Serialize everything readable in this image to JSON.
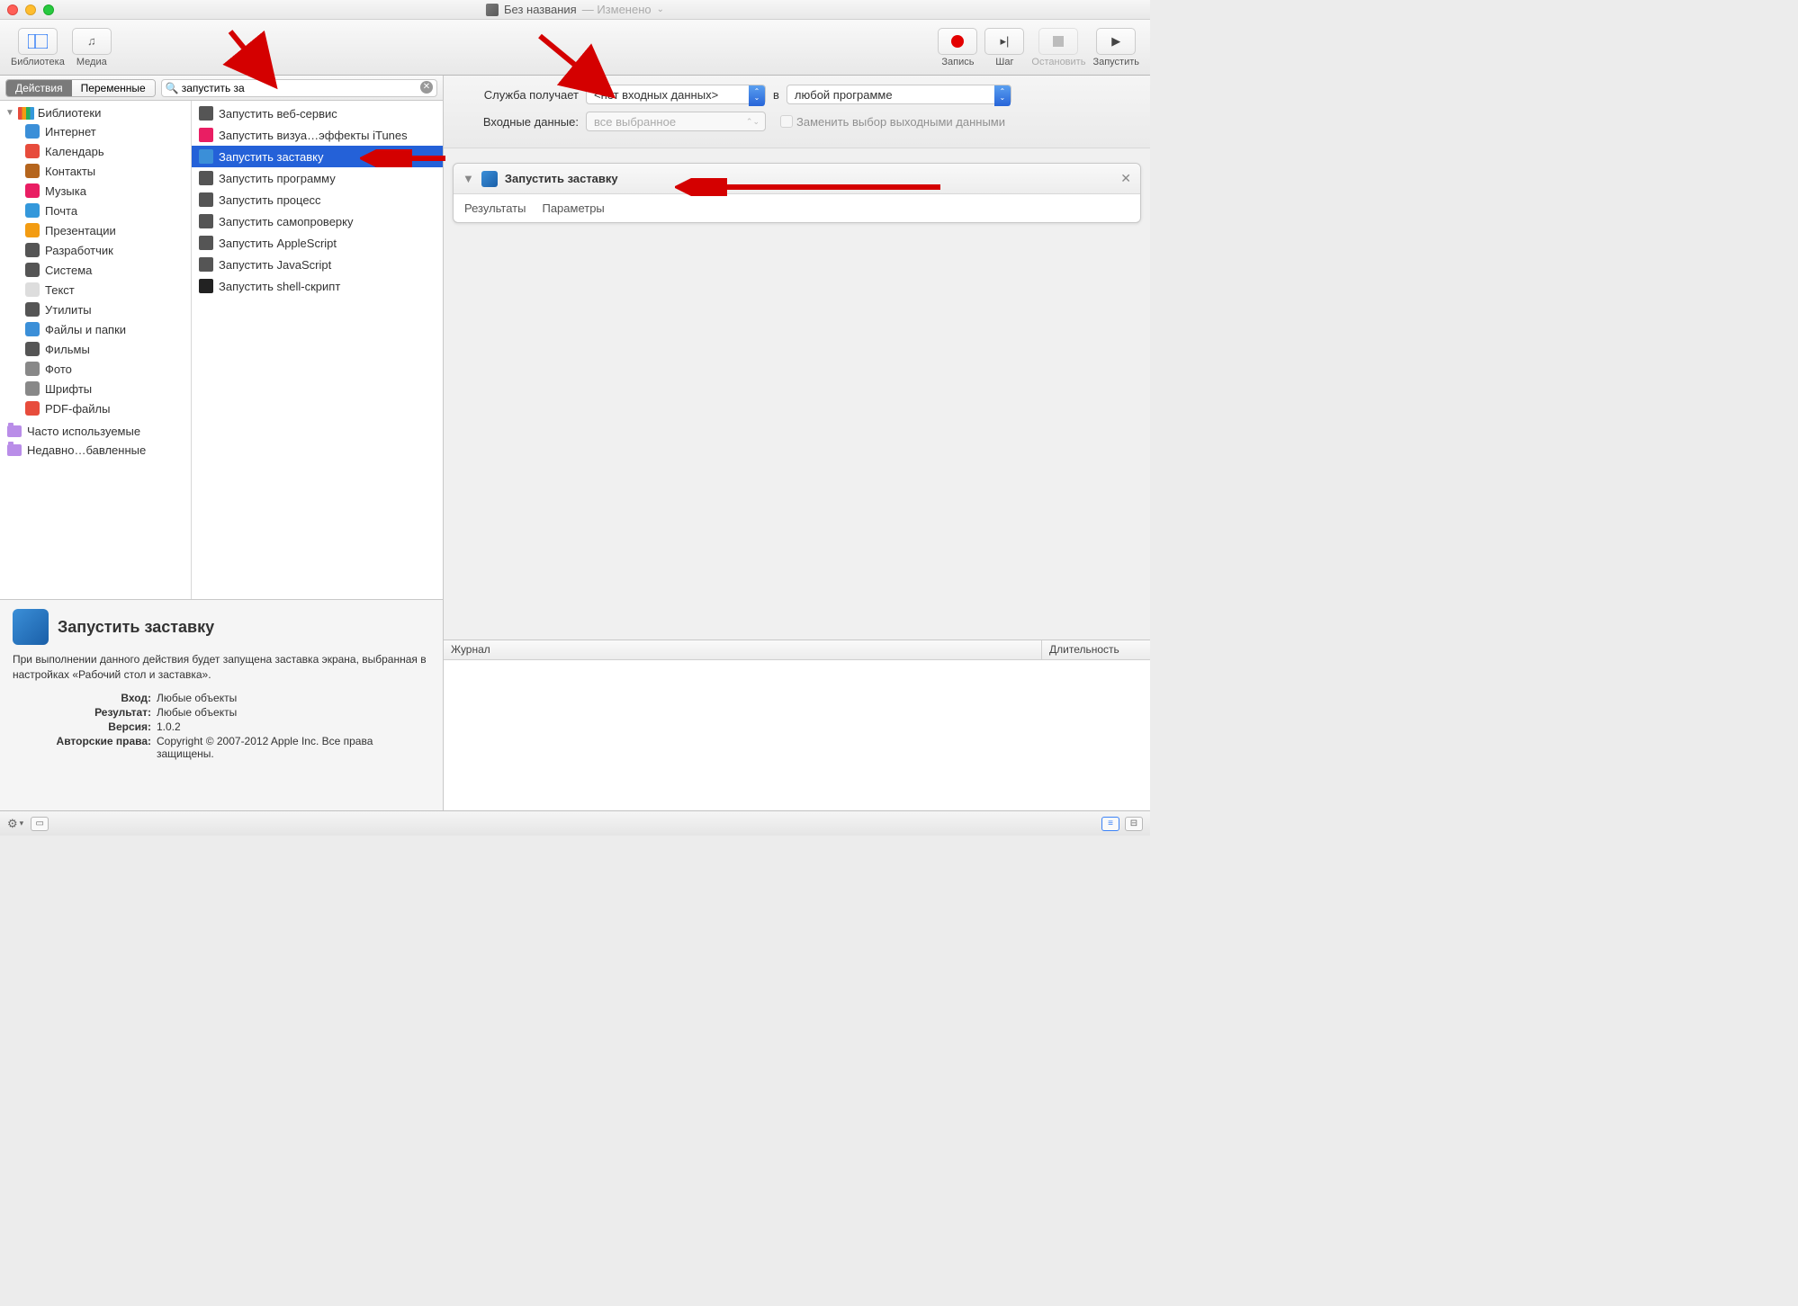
{
  "window": {
    "title": "Без названия",
    "modified": "— Изменено"
  },
  "toolbar": {
    "library": "Библиотека",
    "media": "Медиа",
    "record": "Запись",
    "step": "Шаг",
    "stop": "Остановить",
    "run": "Запустить"
  },
  "tabs": {
    "actions": "Действия",
    "variables": "Переменные"
  },
  "search": {
    "value": "запустить за"
  },
  "sidebar": {
    "libraries": "Библиотеки",
    "items": [
      {
        "label": "Интернет",
        "color": "#3b8fd8"
      },
      {
        "label": "Календарь",
        "color": "#e74c3c"
      },
      {
        "label": "Контакты",
        "color": "#b5651d"
      },
      {
        "label": "Музыка",
        "color": "#e91e63"
      },
      {
        "label": "Почта",
        "color": "#3498db"
      },
      {
        "label": "Презентации",
        "color": "#f39c12"
      },
      {
        "label": "Разработчик",
        "color": "#555"
      },
      {
        "label": "Система",
        "color": "#555"
      },
      {
        "label": "Текст",
        "color": "#ddd"
      },
      {
        "label": "Утилиты",
        "color": "#555"
      },
      {
        "label": "Файлы и папки",
        "color": "#3b8fd8"
      },
      {
        "label": "Фильмы",
        "color": "#555"
      },
      {
        "label": "Фото",
        "color": "#888"
      },
      {
        "label": "Шрифты",
        "color": "#888"
      },
      {
        "label": "PDF-файлы",
        "color": "#e74c3c"
      }
    ],
    "smart": [
      "Часто используемые",
      "Недавно…бавленные"
    ]
  },
  "actions": [
    {
      "label": "Запустить веб-сервис",
      "selected": false,
      "icon": "#555"
    },
    {
      "label": "Запустить визуа…эффекты iTunes",
      "selected": false,
      "icon": "#e91e63"
    },
    {
      "label": "Запустить заставку",
      "selected": true,
      "icon": "#3b8fd8"
    },
    {
      "label": "Запустить программу",
      "selected": false,
      "icon": "#555"
    },
    {
      "label": "Запустить процесс",
      "selected": false,
      "icon": "#555"
    },
    {
      "label": "Запустить самопроверку",
      "selected": false,
      "icon": "#555"
    },
    {
      "label": "Запустить AppleScript",
      "selected": false,
      "icon": "#555"
    },
    {
      "label": "Запустить JavaScript",
      "selected": false,
      "icon": "#555"
    },
    {
      "label": "Запустить shell-скрипт",
      "selected": false,
      "icon": "#222"
    }
  ],
  "info": {
    "title": "Запустить заставку",
    "description": "При выполнении данного действия будет запущена заставка экрана, выбранная в настройках «Рабочий стол и заставка».",
    "rows": [
      {
        "label": "Вход:",
        "value": "Любые объекты"
      },
      {
        "label": "Результат:",
        "value": "Любые объекты"
      },
      {
        "label": "Версия:",
        "value": "1.0.2"
      },
      {
        "label": "Авторские права:",
        "value": "Copyright © 2007-2012 Apple Inc. Все права защищены."
      }
    ]
  },
  "config": {
    "service_receives_label": "Служба получает",
    "service_receives_value": "<нет входных данных>",
    "in_label": "в",
    "in_value": "любой программе",
    "input_data_label": "Входные данные:",
    "input_data_value": "все выбранное",
    "replace_checkbox": "Заменить выбор выходными данными"
  },
  "workflow": {
    "action_title": "Запустить заставку",
    "results": "Результаты",
    "parameters": "Параметры"
  },
  "log": {
    "col1": "Журнал",
    "col2": "Длительность"
  }
}
